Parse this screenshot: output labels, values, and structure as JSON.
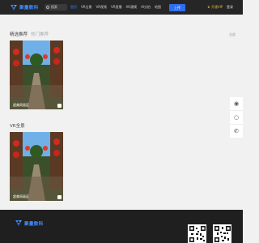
{
  "brand": {
    "name": "聚量数科",
    "accent": "#3d8bff"
  },
  "header": {
    "search_label": "搜索",
    "nav": [
      "首页",
      "VR全景",
      "VR视频",
      "VR直播",
      "AR建模",
      "AI分拍",
      "地图"
    ],
    "upload_label": "上传",
    "vip_label": "开通VIP",
    "login_label": "登录",
    "register_label": "登录"
  },
  "featured": {
    "title": "精选推荐",
    "tab": "热门推荐",
    "more_label": "全部",
    "card": {
      "label": "超美网画区"
    }
  },
  "vr": {
    "title": "VR全景",
    "card": {
      "label": "超美网画区"
    }
  },
  "side": {
    "icons": [
      "qq-icon",
      "wechat-icon",
      "phone-icon"
    ]
  },
  "footer": {
    "brand": "聚量数科",
    "qr_codes": [
      "qr-code-1",
      "qr-code-2"
    ]
  }
}
